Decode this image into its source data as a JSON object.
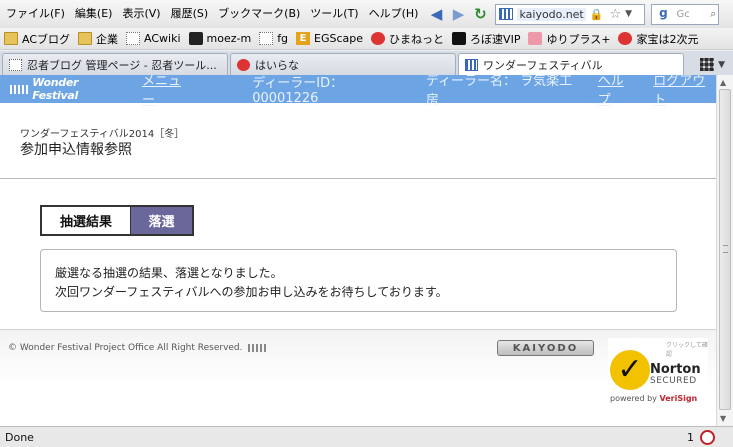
{
  "menubar": {
    "items": [
      "ファイル(F)",
      "編集(E)",
      "表示(V)",
      "履歴(S)",
      "ブックマーク(B)",
      "ツール(T)",
      "ヘルプ(H)"
    ],
    "url": "kaiyodo.net",
    "search_placeholder": "Gc"
  },
  "bookmarks": {
    "items": [
      "ACブログ",
      "企業",
      "ACwiki",
      "moez-m",
      "fg",
      "EGScape",
      "ひまねっと",
      "ろぼ速VIP",
      "ゆりプラス+",
      "家宝は2次元"
    ]
  },
  "tabs": [
    {
      "label": "忍者ブログ 管理ページ - 忍者ツール..."
    },
    {
      "label": "はいらな"
    },
    {
      "label": "ワンダーフェスティバル"
    }
  ],
  "site_header": {
    "logo": "Wonder Festival",
    "menu_link": "メニュー",
    "dealer_id_label": "ディーラーID：",
    "dealer_id": "00001226",
    "dealer_name_label": "ディーラー名：",
    "dealer_name": "ヲ気楽工房",
    "help_link": "ヘルプ",
    "logout_link": "ログアウト"
  },
  "page": {
    "event_name": "ワンダーフェスティバル2014［冬］",
    "title": "参加申込情報参照",
    "result_label": "抽選結果",
    "result_value": "落選",
    "message_line1": "厳選なる抽選の結果、落選となりました。",
    "message_line2": "次回ワンダーフェスティバルへの参加お申し込みをお待ちしております。"
  },
  "footer": {
    "copyright": "© Wonder Festival Project Office All Right Reserved.",
    "kaiyodo_logo": "KAIYODO",
    "norton_small": "クリックして確認",
    "norton_name": "Norton",
    "norton_secured": "SECURED",
    "norton_powered": "powered by",
    "norton_verisign": "VeriSign"
  },
  "statusbar": {
    "status": "Done",
    "count": "1"
  },
  "colors": {
    "header_bg": "#6ca4e4",
    "result_value_bg": "#6a679a",
    "norton_yellow": "#f2c200"
  }
}
